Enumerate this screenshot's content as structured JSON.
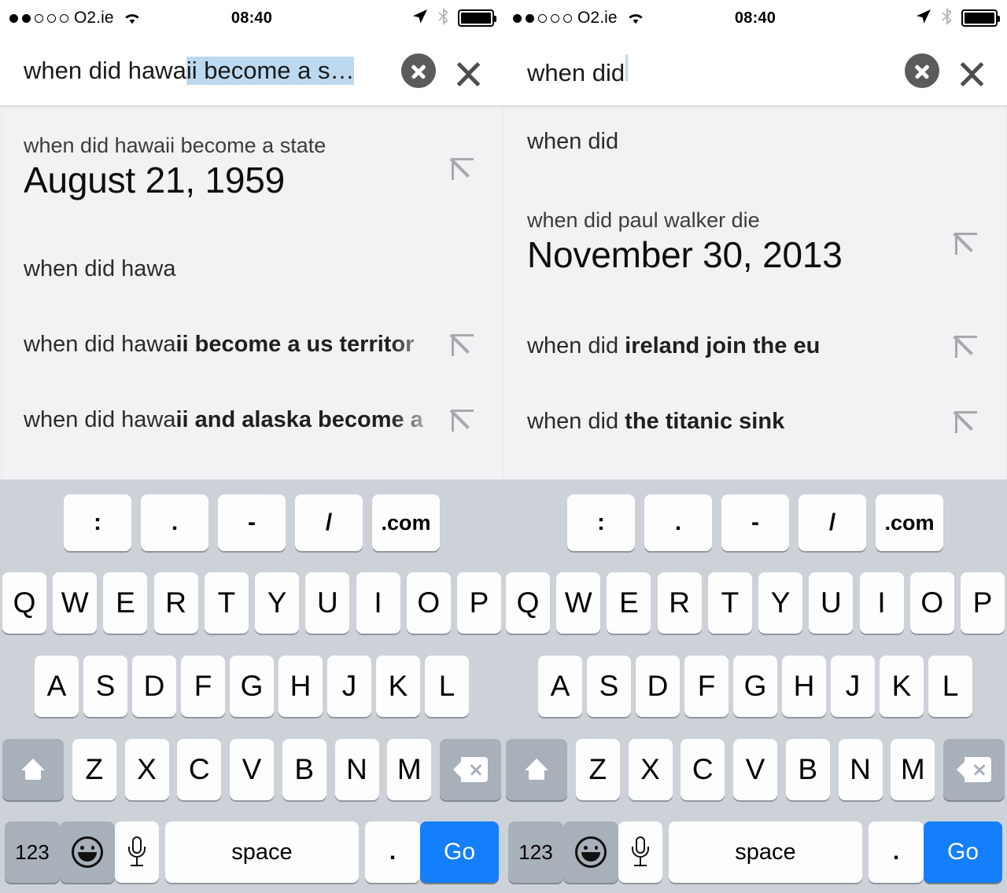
{
  "status_bar": {
    "signal_total": 5,
    "signal_filled": 2,
    "carrier": "O2.ie",
    "wifi_icon": "wifi-icon",
    "time": "08:40",
    "location_icon": "location-arrow-icon",
    "bluetooth_icon": "bluetooth-icon",
    "battery_icon": "battery-full-icon",
    "battery_level": 100
  },
  "panes": [
    {
      "search": {
        "value_plain": "when did hawa",
        "value_selected": "ii become a s…",
        "has_caret": false,
        "clear_label": "clear-text",
        "collapse_label": "collapse-keyboard"
      },
      "suggestions": [
        {
          "type": "answer",
          "question": "when did hawaii become a state",
          "answer": "August 21, 1959",
          "has_arrow": true
        },
        {
          "type": "plain",
          "prefix": "when did hawa",
          "bold": "",
          "has_arrow": false
        },
        {
          "type": "plain",
          "prefix": "when did hawa",
          "bold": "ii become a us territor",
          "has_arrow": true
        },
        {
          "type": "plain",
          "prefix": "when did hawa",
          "bold": "ii and alaska become a",
          "has_arrow": true
        }
      ]
    },
    {
      "search": {
        "value_plain": "when did",
        "value_selected": "",
        "has_caret": true,
        "clear_label": "clear-text",
        "collapse_label": "collapse-keyboard"
      },
      "suggestions": [
        {
          "type": "plain",
          "prefix": "when did",
          "bold": "",
          "has_arrow": false
        },
        {
          "type": "answer",
          "question": "when did paul walker die",
          "answer": "November 30, 2013",
          "has_arrow": true
        },
        {
          "type": "plain",
          "prefix": "when did ",
          "bold": "ireland join the eu",
          "has_arrow": true
        },
        {
          "type": "plain",
          "prefix": "when did ",
          "bold": "the titanic sink",
          "has_arrow": true
        }
      ]
    }
  ],
  "keyboard": {
    "accessory_row": [
      ":",
      ".",
      "-",
      "/",
      ".com"
    ],
    "row1": [
      "Q",
      "W",
      "E",
      "R",
      "T",
      "Y",
      "U",
      "I",
      "O",
      "P"
    ],
    "row2": [
      "A",
      "S",
      "D",
      "F",
      "G",
      "H",
      "J",
      "K",
      "L"
    ],
    "row3": [
      "Z",
      "X",
      "C",
      "V",
      "B",
      "N",
      "M"
    ],
    "shift_label": "shift",
    "backspace_label": "backspace",
    "numeric_label": "123",
    "emoji_label": "emoji",
    "dictation_label": "dictation",
    "space_label": "space",
    "period_label": ".",
    "go_label": "Go"
  },
  "colors": {
    "keyboard_bg": "#cdd2d9",
    "key_bg": "#fdfdfd",
    "key_dark_bg": "#a8b0ba",
    "go_blue": "#147efb",
    "suggestion_bg": "#f2f2f4",
    "selection_highlight": "#bcd9ef",
    "arrow_gray": "#a9a9ad"
  }
}
